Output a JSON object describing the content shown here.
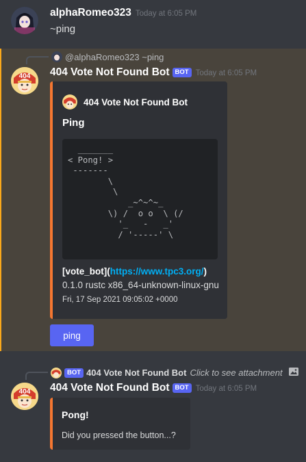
{
  "messages": [
    {
      "author": "alphaRomeo323",
      "timestamp": "Today at 6:05 PM",
      "content": "~ping"
    },
    {
      "reply": {
        "author": "@alphaRomeo323",
        "text": "~ping"
      },
      "author": "404 Vote Not Found Bot",
      "bot_tag": "BOT",
      "timestamp": "Today at 6:05 PM",
      "embed": {
        "author": "404 Vote Not Found Bot",
        "title": "Ping",
        "code": "  _______\n< Pong! >\n -------\n        \\\n         \\\n            _~^~^~_\n        \\) /  o o  \\ (/\n          '_   -   _'\n          / '-----' \\",
        "desc_prefix": "[vote_bot](",
        "link": "https://www.tpc3.org/",
        "desc_suffix": ")",
        "version": "0.1.0 rustc x86_64-unknown-linux-gnu",
        "footer": "Fri, 17 Sep 2021 09:05:02 +0000",
        "color": "#f57731"
      },
      "button_label": "ping"
    },
    {
      "reply": {
        "bot_tag": "BOT",
        "author": "404 Vote Not Found Bot",
        "text": "Click to see attachment"
      },
      "author": "404 Vote Not Found Bot",
      "bot_tag": "BOT",
      "timestamp": "Today at 6:05 PM",
      "embed": {
        "title": "Pong!",
        "description": "Did you pressed the button...?"
      }
    }
  ],
  "colors": {
    "background": "#36393f",
    "highlight": "#49443c",
    "mention_bar": "#faa81a",
    "embed_bg": "#2f3136",
    "blurple": "#5865f2",
    "link": "#00aff4"
  }
}
